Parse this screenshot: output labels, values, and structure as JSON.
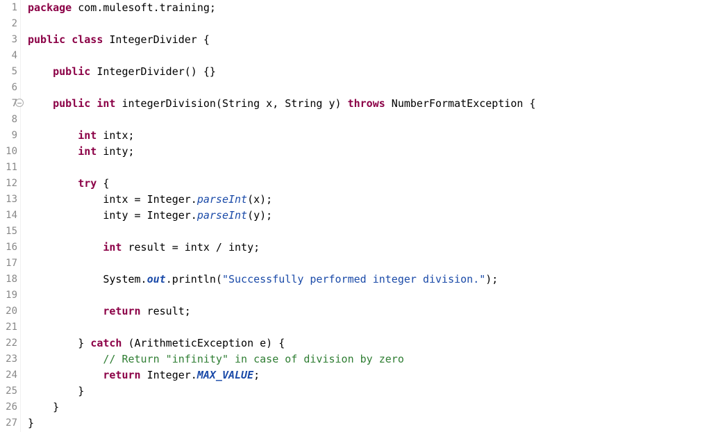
{
  "lineCount": 27,
  "foldLine": 7,
  "lines": {
    "l1": [
      {
        "t": "package ",
        "c": "kw"
      },
      {
        "t": "com.mulesoft.training;",
        "c": "pkg"
      }
    ],
    "l2": [
      {
        "t": "",
        "c": ""
      }
    ],
    "l3": [
      {
        "t": "public class ",
        "c": "kw"
      },
      {
        "t": "IntegerDivider {",
        "c": "cls"
      }
    ],
    "l4": [
      {
        "t": "",
        "c": ""
      }
    ],
    "l5": [
      {
        "t": "    ",
        "c": ""
      },
      {
        "t": "public",
        "c": "kw"
      },
      {
        "t": " IntegerDivider() {}",
        "c": ""
      }
    ],
    "l6": [
      {
        "t": "",
        "c": ""
      }
    ],
    "l7": [
      {
        "t": "    ",
        "c": ""
      },
      {
        "t": "public int",
        "c": "kw"
      },
      {
        "t": " integerDivision(String x, String y) ",
        "c": ""
      },
      {
        "t": "throws",
        "c": "kw"
      },
      {
        "t": " NumberFormatException {",
        "c": ""
      }
    ],
    "l8": [
      {
        "t": "",
        "c": ""
      }
    ],
    "l9": [
      {
        "t": "        ",
        "c": ""
      },
      {
        "t": "int",
        "c": "kw"
      },
      {
        "t": " intx;",
        "c": ""
      }
    ],
    "l10": [
      {
        "t": "        ",
        "c": ""
      },
      {
        "t": "int",
        "c": "kw"
      },
      {
        "t": " inty;",
        "c": ""
      }
    ],
    "l11": [
      {
        "t": "",
        "c": ""
      }
    ],
    "l12": [
      {
        "t": "        ",
        "c": ""
      },
      {
        "t": "try",
        "c": "kw"
      },
      {
        "t": " {",
        "c": ""
      }
    ],
    "l13": [
      {
        "t": "            intx = Integer.",
        "c": ""
      },
      {
        "t": "parseInt",
        "c": "static-it"
      },
      {
        "t": "(x);",
        "c": ""
      }
    ],
    "l14": [
      {
        "t": "            inty = Integer.",
        "c": ""
      },
      {
        "t": "parseInt",
        "c": "static-it"
      },
      {
        "t": "(y);",
        "c": ""
      }
    ],
    "l15": [
      {
        "t": "",
        "c": ""
      }
    ],
    "l16": [
      {
        "t": "            ",
        "c": ""
      },
      {
        "t": "int",
        "c": "kw"
      },
      {
        "t": " result = intx / inty;",
        "c": ""
      }
    ],
    "l17": [
      {
        "t": "",
        "c": ""
      }
    ],
    "l18": [
      {
        "t": "            System.",
        "c": ""
      },
      {
        "t": "out",
        "c": "static-bold-it"
      },
      {
        "t": ".println(",
        "c": ""
      },
      {
        "t": "\"Successfully performed integer division.\"",
        "c": "str"
      },
      {
        "t": ");",
        "c": ""
      }
    ],
    "l19": [
      {
        "t": "",
        "c": ""
      }
    ],
    "l20": [
      {
        "t": "            ",
        "c": ""
      },
      {
        "t": "return",
        "c": "kw"
      },
      {
        "t": " result;",
        "c": ""
      }
    ],
    "l21": [
      {
        "t": "",
        "c": ""
      }
    ],
    "l22": [
      {
        "t": "        } ",
        "c": ""
      },
      {
        "t": "catch",
        "c": "kw"
      },
      {
        "t": " (ArithmeticException e) {",
        "c": ""
      }
    ],
    "l23": [
      {
        "t": "            ",
        "c": ""
      },
      {
        "t": "// Return \"infinity\" in case of division by zero",
        "c": "comment"
      }
    ],
    "l24": [
      {
        "t": "            ",
        "c": ""
      },
      {
        "t": "return",
        "c": "kw"
      },
      {
        "t": " Integer.",
        "c": ""
      },
      {
        "t": "MAX_VALUE",
        "c": "static-bold-it"
      },
      {
        "t": ";",
        "c": ""
      }
    ],
    "l25": [
      {
        "t": "        }",
        "c": ""
      }
    ],
    "l26": [
      {
        "t": "    }",
        "c": ""
      }
    ],
    "l27": [
      {
        "t": "}",
        "c": ""
      }
    ]
  },
  "foldGlyph": "⊖"
}
